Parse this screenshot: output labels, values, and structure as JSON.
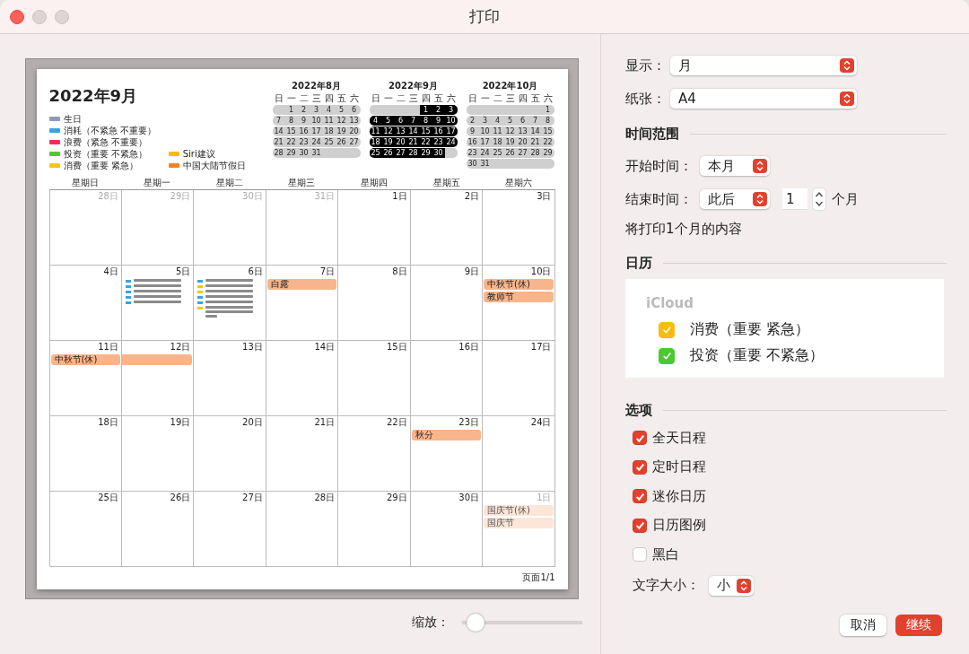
{
  "window": {
    "title": "打印"
  },
  "preview": {
    "sheet": {
      "title": "2022年9月",
      "legend_columns": [
        [
          {
            "label": "生日",
            "color": "#8a9bb8"
          },
          {
            "label": "消耗（不紧急 不重要）",
            "color": "#38a4e4"
          },
          {
            "label": "浪费（紧急 不重要）",
            "color": "#f0305a"
          },
          {
            "label": "投资（重要 不紧急）",
            "color": "#52c832"
          },
          {
            "label": "消费（重要 紧急）",
            "color": "#f8c414"
          }
        ],
        [
          {
            "label": "Siri建议",
            "color": "#f8bc10"
          },
          {
            "label": "中国大陆节假日",
            "color": "#f58220"
          }
        ]
      ],
      "mini_calendars": [
        {
          "title": "2022年8月",
          "selected": false,
          "weekdays": [
            "日",
            "一",
            "二",
            "三",
            "四",
            "五",
            "六"
          ],
          "weeks": [
            [
              "1",
              "2",
              "3",
              "4",
              "5",
              "6"
            ],
            [
              "7",
              "8",
              "9",
              "10",
              "11",
              "12",
              "13"
            ],
            [
              "14",
              "15",
              "16",
              "17",
              "18",
              "19",
              "20"
            ],
            [
              "21",
              "22",
              "23",
              "24",
              "25",
              "26",
              "27"
            ],
            [
              "28",
              "29",
              "30",
              "31"
            ]
          ]
        },
        {
          "title": "2022年9月",
          "selected": true,
          "weekdays": [
            "日",
            "一",
            "二",
            "三",
            "四",
            "五",
            "六"
          ],
          "weeks": [
            [
              "1",
              "2",
              "3"
            ],
            [
              "4",
              "5",
              "6",
              "7",
              "8",
              "9",
              "10"
            ],
            [
              "11",
              "12",
              "13",
              "14",
              "15",
              "16",
              "17"
            ],
            [
              "18",
              "19",
              "20",
              "21",
              "22",
              "23",
              "24"
            ],
            [
              "25",
              "26",
              "27",
              "28",
              "29",
              "30"
            ]
          ]
        },
        {
          "title": "2022年10月",
          "selected": false,
          "weekdays": [
            "日",
            "一",
            "二",
            "三",
            "四",
            "五",
            "六"
          ],
          "weeks": [
            [
              "1"
            ],
            [
              "2",
              "3",
              "4",
              "5",
              "6",
              "7",
              "8"
            ],
            [
              "9",
              "10",
              "11",
              "12",
              "13",
              "14",
              "15"
            ],
            [
              "16",
              "17",
              "18",
              "19",
              "20",
              "21",
              "22"
            ],
            [
              "23",
              "24",
              "25",
              "26",
              "27",
              "28",
              "29"
            ],
            [
              "30",
              "31"
            ]
          ]
        }
      ],
      "weekdays": [
        "星期日",
        "星期一",
        "星期二",
        "星期三",
        "星期四",
        "星期五",
        "星期六"
      ],
      "weeks": [
        [
          {
            "label": "28日",
            "muted": true
          },
          {
            "label": "29日",
            "muted": true
          },
          {
            "label": "30日",
            "muted": true
          },
          {
            "label": "31日",
            "muted": true
          },
          {
            "label": "1日",
            "muted": false
          },
          {
            "label": "2日",
            "muted": false
          },
          {
            "label": "3日",
            "muted": false
          }
        ],
        [
          {
            "label": "4日",
            "muted": false
          },
          {
            "label": "5日",
            "muted": false,
            "events": [
              {
                "kind": "timed",
                "color": "#38a4e4"
              },
              {
                "kind": "timed",
                "color": "#38a4e4"
              },
              {
                "kind": "timed",
                "color": "#38a4e4"
              },
              {
                "kind": "timed",
                "color": "#38a4e4"
              },
              {
                "kind": "timed",
                "color": "#38a4e4"
              }
            ]
          },
          {
            "label": "6日",
            "muted": false,
            "events": [
              {
                "kind": "timed",
                "color": "#38a4e4"
              },
              {
                "kind": "timed",
                "color": "#f8c414"
              },
              {
                "kind": "timed",
                "color": "#f8c414"
              },
              {
                "kind": "timed",
                "color": "#38a4e4"
              },
              {
                "kind": "timed",
                "color": "#38a4e4"
              },
              {
                "kind": "timed",
                "color": "#f8c414",
                "wrapped": true
              }
            ]
          },
          {
            "label": "7日",
            "muted": false,
            "events": [
              {
                "kind": "allday",
                "title": "白露"
              }
            ]
          },
          {
            "label": "8日",
            "muted": false
          },
          {
            "label": "9日",
            "muted": false
          },
          {
            "label": "10日",
            "muted": false,
            "events": [
              {
                "kind": "allday",
                "title": "中秋节(休)"
              },
              {
                "kind": "allday",
                "title": "教师节"
              }
            ]
          }
        ],
        [
          {
            "label": "11日",
            "muted": false,
            "events": [
              {
                "kind": "allday",
                "title": "中秋节(休)"
              }
            ]
          },
          {
            "label": "12日",
            "muted": false,
            "events": [
              {
                "kind": "allday-continued"
              }
            ]
          },
          {
            "label": "13日",
            "muted": false
          },
          {
            "label": "14日",
            "muted": false
          },
          {
            "label": "15日",
            "muted": false
          },
          {
            "label": "16日",
            "muted": false
          },
          {
            "label": "17日",
            "muted": false
          }
        ],
        [
          {
            "label": "18日",
            "muted": false
          },
          {
            "label": "19日",
            "muted": false
          },
          {
            "label": "20日",
            "muted": false
          },
          {
            "label": "21日",
            "muted": false
          },
          {
            "label": "22日",
            "muted": false
          },
          {
            "label": "23日",
            "muted": false,
            "events": [
              {
                "kind": "allday",
                "title": "秋分"
              }
            ]
          },
          {
            "label": "24日",
            "muted": false
          }
        ],
        [
          {
            "label": "25日",
            "muted": false
          },
          {
            "label": "26日",
            "muted": false
          },
          {
            "label": "27日",
            "muted": false
          },
          {
            "label": "28日",
            "muted": false
          },
          {
            "label": "29日",
            "muted": false
          },
          {
            "label": "30日",
            "muted": false
          },
          {
            "label": "1日",
            "muted": true,
            "events": [
              {
                "kind": "allday",
                "title": "国庆节(休)"
              },
              {
                "kind": "allday",
                "title": "国庆节"
              }
            ]
          }
        ]
      ],
      "footer": "页面1/1"
    },
    "zoom": {
      "label": "缩放：",
      "level": 0.04
    }
  },
  "settings": {
    "selects": [
      {
        "label": "显示：",
        "value": "月"
      },
      {
        "label": "纸张：",
        "value": "A4"
      }
    ],
    "time_range": {
      "heading": "时间范围",
      "start": {
        "label": "开始时间：",
        "value": "本月"
      },
      "end": {
        "label": "结束时间：",
        "value": "此后",
        "count": "1",
        "unit": "个月"
      },
      "note": "将打印1个月的内容"
    },
    "calendars": {
      "heading": "日历",
      "account": "iCloud",
      "items": [
        {
          "label": "消费（重要 紧急）",
          "checked": true,
          "color": "#f8bc10"
        },
        {
          "label": "投资（重要 不紧急）",
          "checked": true,
          "color": "#4cc832"
        }
      ]
    },
    "options": {
      "heading": "选项",
      "items": [
        {
          "label": "全天日程",
          "checked": true
        },
        {
          "label": "定时日程",
          "checked": true
        },
        {
          "label": "迷你日历",
          "checked": true
        },
        {
          "label": "日历图例",
          "checked": true
        },
        {
          "label": "黑白",
          "checked": false
        }
      ],
      "text_size": {
        "label": "文字大小：",
        "value": "小"
      }
    }
  },
  "buttons": [
    {
      "label": "取消",
      "kind": "secondary"
    },
    {
      "label": "继续",
      "kind": "primary"
    }
  ]
}
